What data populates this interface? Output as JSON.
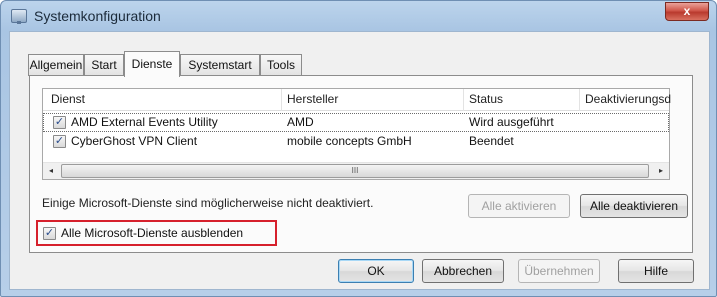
{
  "window": {
    "title": "Systemkonfiguration",
    "close_glyph": "x"
  },
  "tabs": [
    {
      "label": "Allgemein",
      "active": false
    },
    {
      "label": "Start",
      "active": false
    },
    {
      "label": "Dienste",
      "active": true
    },
    {
      "label": "Systemstart",
      "active": false
    },
    {
      "label": "Tools",
      "active": false
    }
  ],
  "services": {
    "columns": [
      "Dienst",
      "Hersteller",
      "Status",
      "Deaktivierungsd"
    ],
    "rows": [
      {
        "checked": true,
        "name": "AMD External Events Utility",
        "vendor": "AMD",
        "status": "Wird ausgeführt"
      },
      {
        "checked": true,
        "name": "CyberGhost VPN Client",
        "vendor": "mobile concepts GmbH",
        "status": "Beendet"
      }
    ],
    "scroll_left": "◂",
    "scroll_right": "▸",
    "scroll_grip": "III"
  },
  "info_text": "Einige Microsoft-Dienste sind möglicherweise nicht deaktiviert.",
  "buttons": {
    "enable_all": "Alle aktivieren",
    "disable_all": "Alle deaktivieren",
    "ok": "OK",
    "cancel": "Abbrechen",
    "apply": "Übernehmen",
    "help": "Hilfe"
  },
  "hide_ms": {
    "checked": true,
    "label": "Alle Microsoft-Dienste ausblenden"
  },
  "icons": {
    "window": "system-config-icon",
    "check": "✓"
  },
  "colors": {
    "highlight_box": "#d6202c",
    "titlebar": "#a9c5e3"
  }
}
